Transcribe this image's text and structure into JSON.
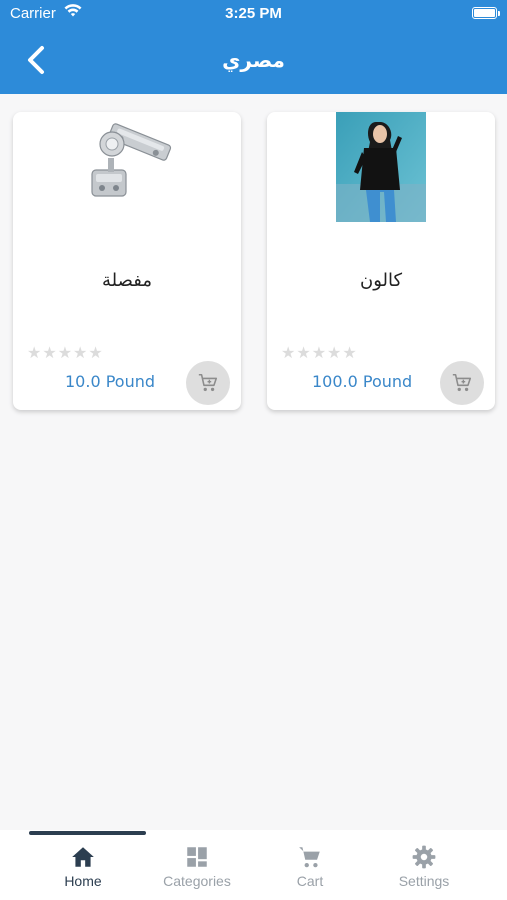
{
  "status_bar": {
    "carrier": "Carrier",
    "time": "3:25 PM"
  },
  "nav": {
    "title": "مصري"
  },
  "products": [
    {
      "name": "مفصلة",
      "price": "10.0 Pound",
      "rating": 0
    },
    {
      "name": "كالون",
      "price": "100.0 Pound",
      "rating": 0
    }
  ],
  "tabs": [
    {
      "label": "Home",
      "icon": "home-icon",
      "active": true
    },
    {
      "label": "Categories",
      "icon": "grid-icon",
      "active": false
    },
    {
      "label": "Cart",
      "icon": "cart-icon",
      "active": false
    },
    {
      "label": "Settings",
      "icon": "gear-icon",
      "active": false
    }
  ],
  "colors": {
    "primary": "#2d8bd9",
    "price": "#3a87c9",
    "tab_active": "#2c3e50",
    "tab_inactive": "#9aa1a8"
  }
}
